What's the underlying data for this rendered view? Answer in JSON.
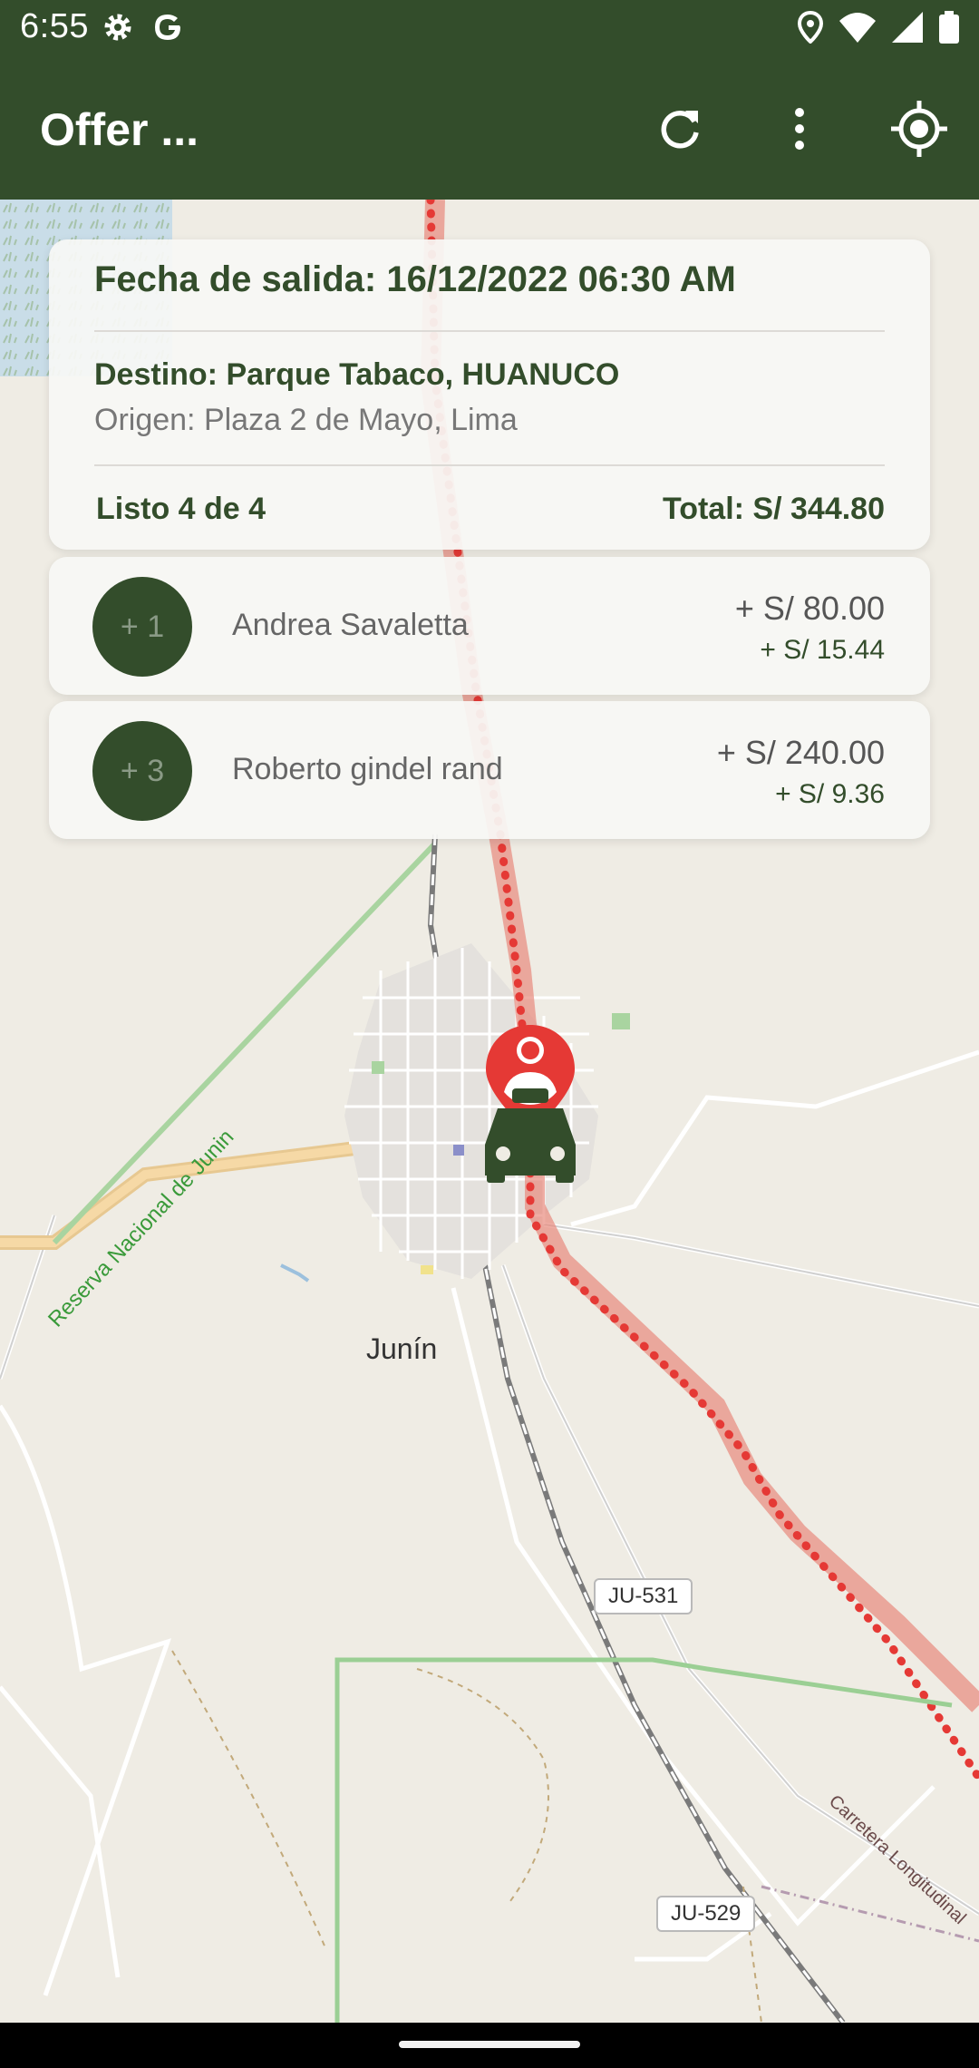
{
  "status_bar": {
    "time": "6:55",
    "icons": [
      "gear-icon",
      "google-icon",
      "location-icon",
      "wifi-icon",
      "signal-icon",
      "battery-icon"
    ]
  },
  "app_bar": {
    "title": "Offer ...",
    "actions": [
      "refresh-icon",
      "more-vert-icon",
      "my-location-icon"
    ]
  },
  "trip": {
    "fecha": "Fecha de salida: 16/12/2022 06:30 AM",
    "destino": "Destino: Parque Tabaco, HUANUCO",
    "origen": "Origen: Plaza 2 de Mayo, Lima",
    "listo": "Listo 4 de 4",
    "total": "Total: S/ 344.80"
  },
  "passengers": [
    {
      "seats": "+ 1",
      "name": "Andrea Savaletta",
      "amount": "+ S/ 80.00",
      "fee": "+ S/ 15.44"
    },
    {
      "seats": "+ 3",
      "name": "Roberto gindel rand",
      "amount": "+ S/ 240.00",
      "fee": "+ S/ 9.36"
    }
  ],
  "map": {
    "city": "Junín",
    "road_labels": [
      "JU-531",
      "JU-529"
    ],
    "reserve_label": "Reserva Nacional de Junin",
    "highway_label": "Carretera Longitudinal",
    "markers": [
      "user-pin-icon",
      "car-icon"
    ]
  },
  "colors": {
    "primary": "#334d2b",
    "route": "#e53935",
    "map_background": "#efece4"
  }
}
